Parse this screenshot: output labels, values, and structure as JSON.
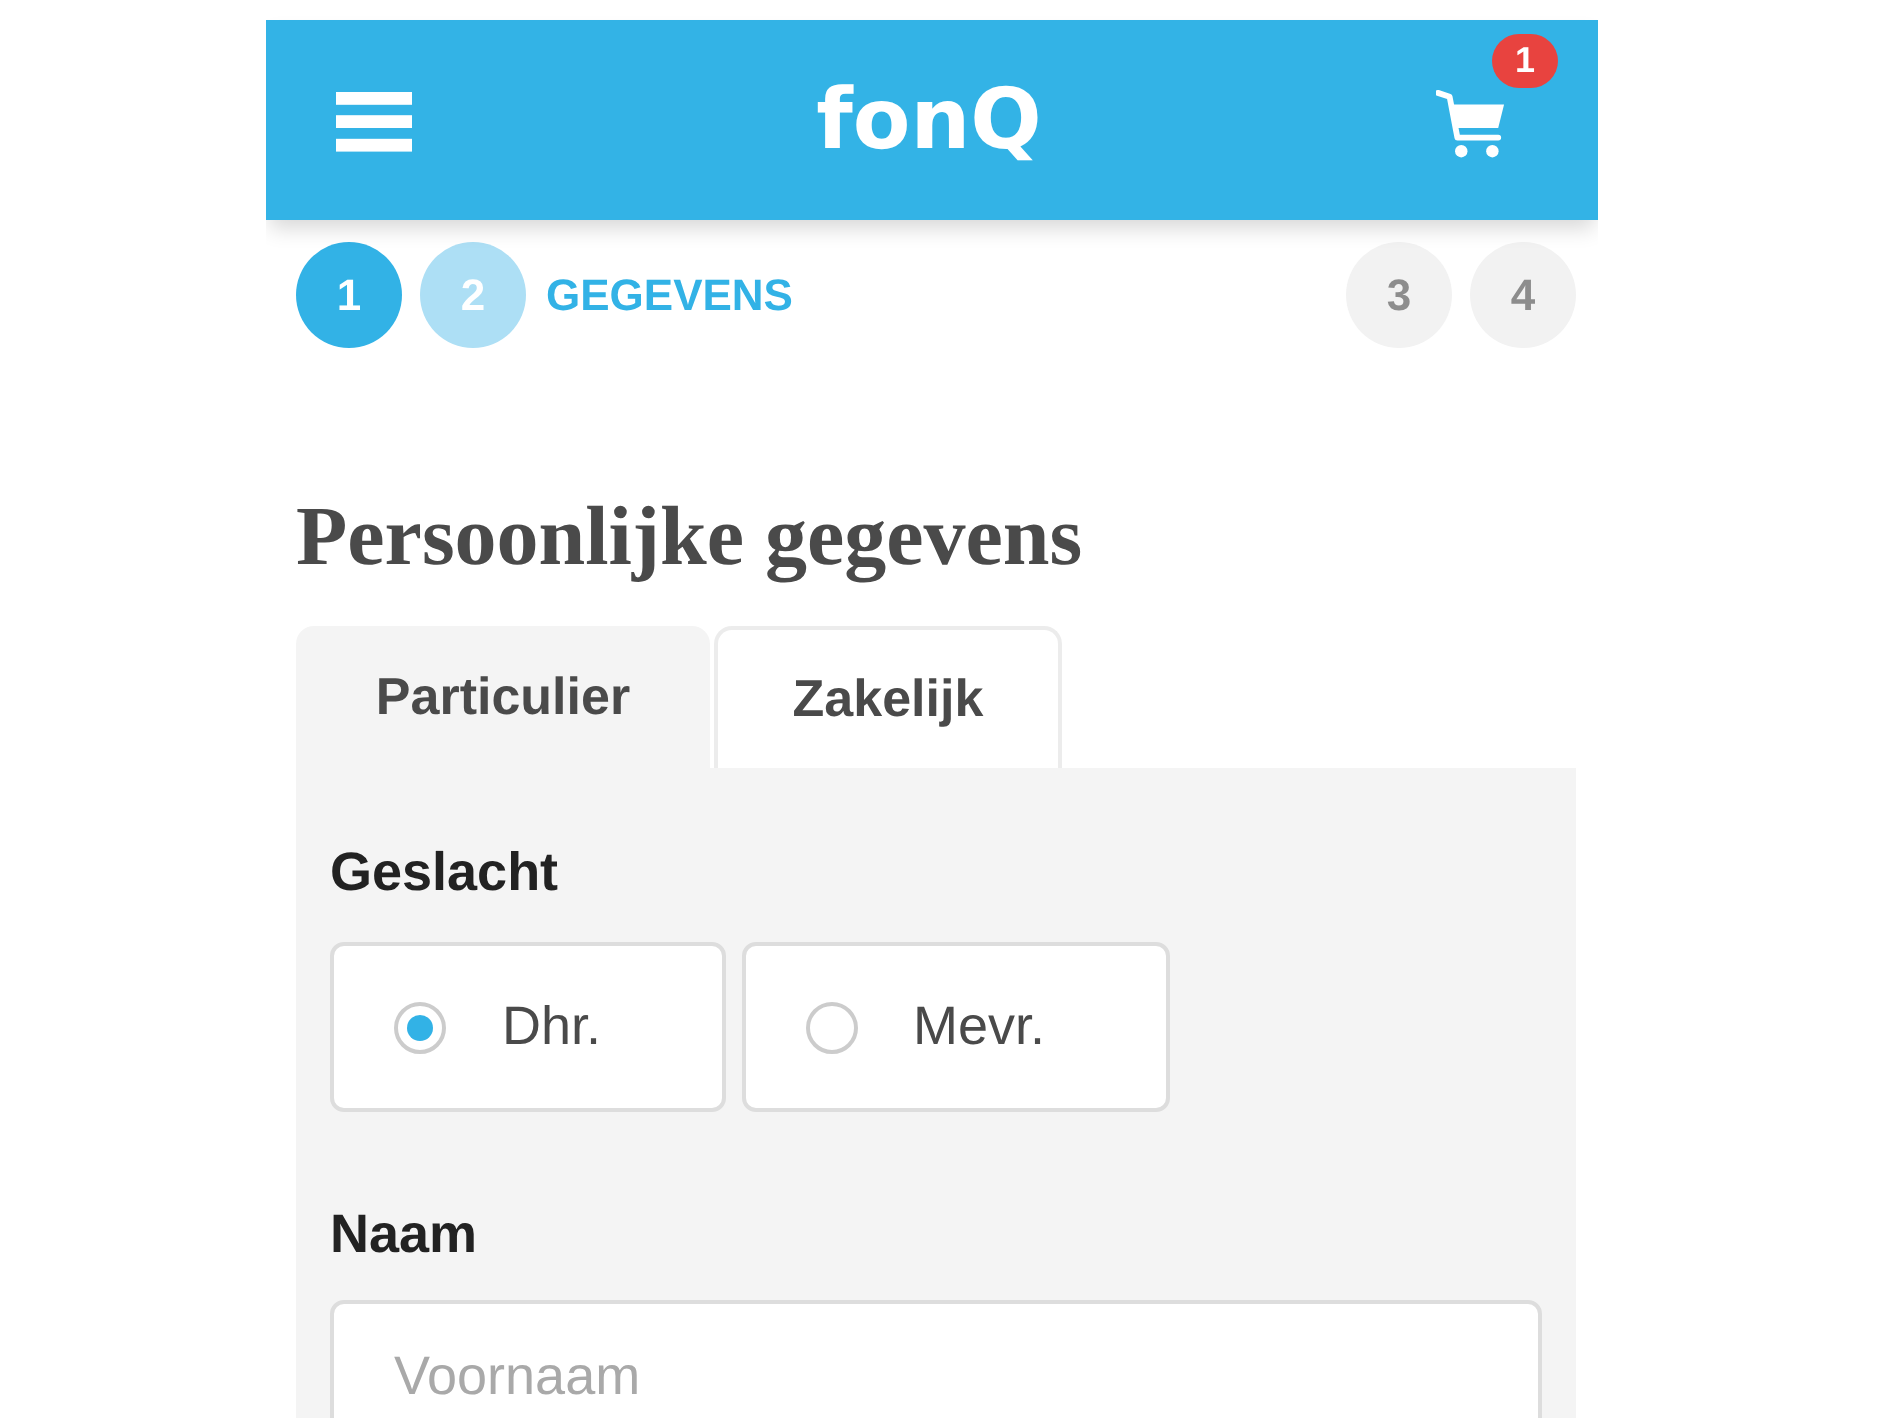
{
  "header": {
    "logo": "fonQ",
    "cart_badge": "1"
  },
  "steps": [
    {
      "number": "1",
      "done": true,
      "selected": false
    },
    {
      "number": "2",
      "done": false,
      "selected": true,
      "label": "GEGEVENS"
    },
    {
      "number": "3",
      "done": false,
      "selected": false
    },
    {
      "number": "4",
      "done": false,
      "selected": false
    }
  ],
  "page_title": "Persoonlijke gegevens",
  "tabs": [
    {
      "label": "Particulier",
      "selected": true
    },
    {
      "label": "Zakelijk",
      "selected": false
    }
  ],
  "form": {
    "gender": {
      "label": "Geslacht",
      "options": [
        {
          "label": "Dhr.",
          "selected": true
        },
        {
          "label": "Mevr.",
          "selected": false
        }
      ]
    },
    "name": {
      "label": "Naam",
      "fields": [
        {
          "placeholder": "Voornaam"
        }
      ]
    }
  }
}
